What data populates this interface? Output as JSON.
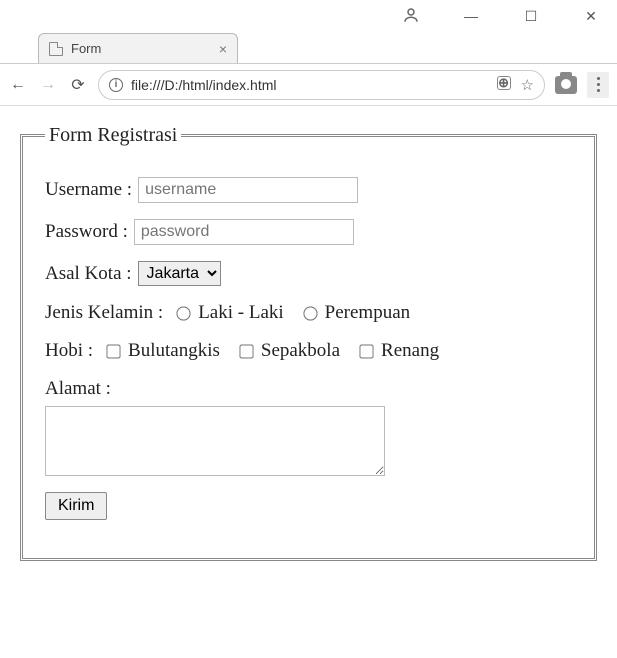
{
  "window": {
    "minimize": "—",
    "maximize": "☐",
    "close": "✕"
  },
  "tab": {
    "title": "Form",
    "close": "×"
  },
  "address": {
    "url": "file:///D:/html/index.html"
  },
  "form": {
    "legend": "Form Registrasi",
    "username": {
      "label": "Username :",
      "placeholder": "username",
      "value": ""
    },
    "password": {
      "label": "Password :",
      "placeholder": "password",
      "value": ""
    },
    "city": {
      "label": "Asal Kota :",
      "selected": "Jakarta"
    },
    "gender": {
      "label": "Jenis Kelamin :",
      "options": {
        "male": "Laki - Laki",
        "female": "Perempuan"
      }
    },
    "hobby": {
      "label": "Hobi :",
      "options": {
        "badminton": "Bulutangkis",
        "football": "Sepakbola",
        "swimming": "Renang"
      }
    },
    "address_field": {
      "label": "Alamat :",
      "value": ""
    },
    "submit": "Kirim"
  }
}
